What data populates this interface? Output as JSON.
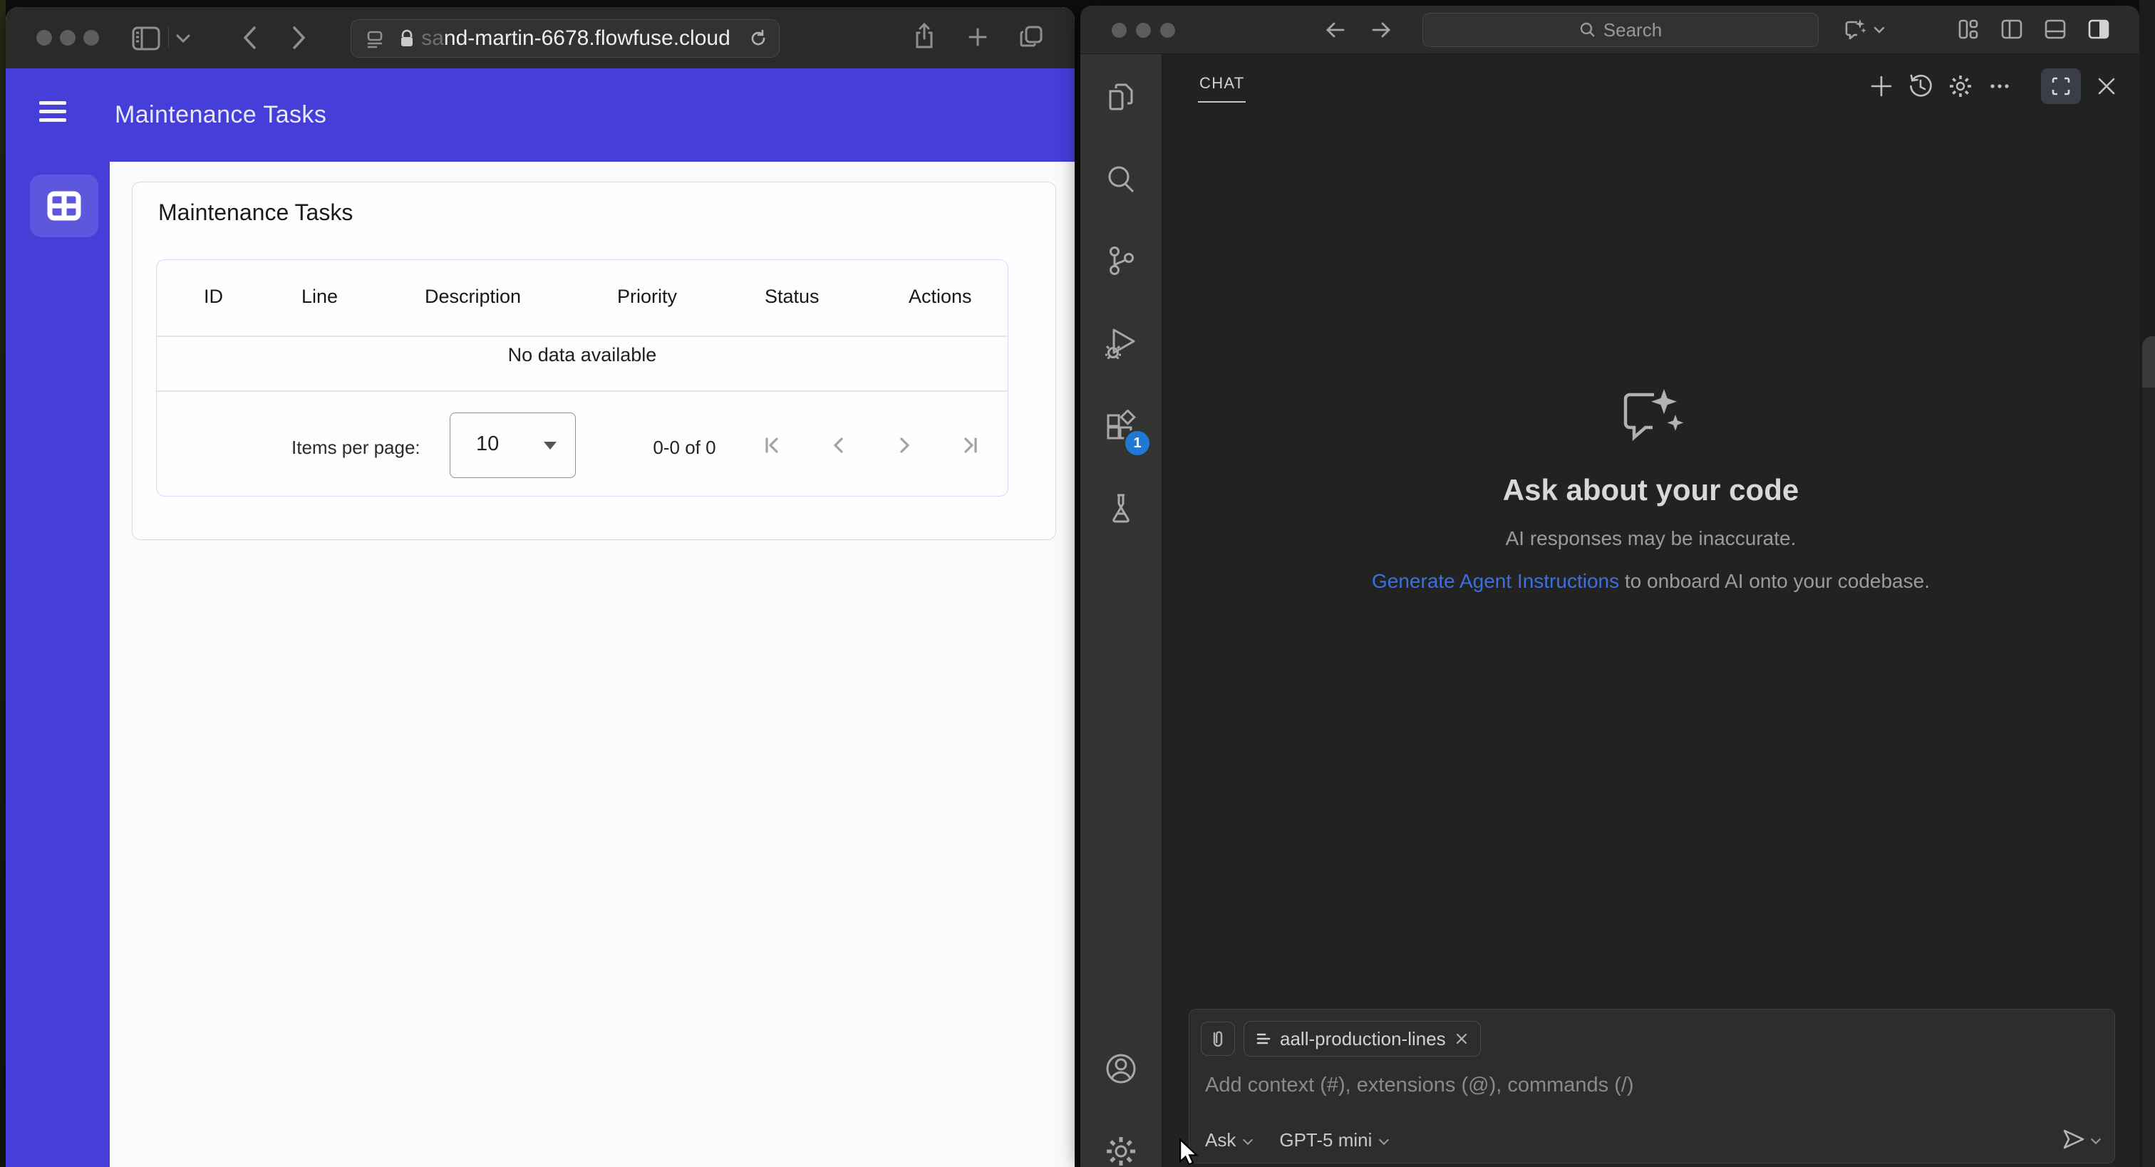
{
  "colors": {
    "app_accent": "#453ed9",
    "link_blue": "#3d6fe0",
    "badge_blue": "#2178d4"
  },
  "safari": {
    "url_prefix": "sa",
    "url": "nd-martin-6678.flowfuse.cloud",
    "app": {
      "header_title": "Maintenance Tasks",
      "card_title": "Maintenance Tasks",
      "table": {
        "columns": [
          "ID",
          "Line",
          "Description",
          "Priority",
          "Status",
          "Actions"
        ],
        "empty_text": "No data available",
        "items_per_page_label": "Items per page:",
        "page_size": "10",
        "range_text": "0-0 of 0"
      }
    }
  },
  "vscode": {
    "search_placeholder": "Search",
    "activity": {
      "extensions_badge": "1"
    },
    "chat": {
      "tab_label": "CHAT",
      "empty_title": "Ask about your code",
      "empty_note": "AI responses may be inaccurate.",
      "link_label": "Generate Agent Instructions",
      "link_tail": " to onboard AI onto your codebase.",
      "context_chip": "aall-production-lines",
      "input_placeholder": "Add context (#), extensions (@), commands (/)",
      "mode_label": "Ask",
      "model_label": "GPT-5 mini"
    }
  }
}
